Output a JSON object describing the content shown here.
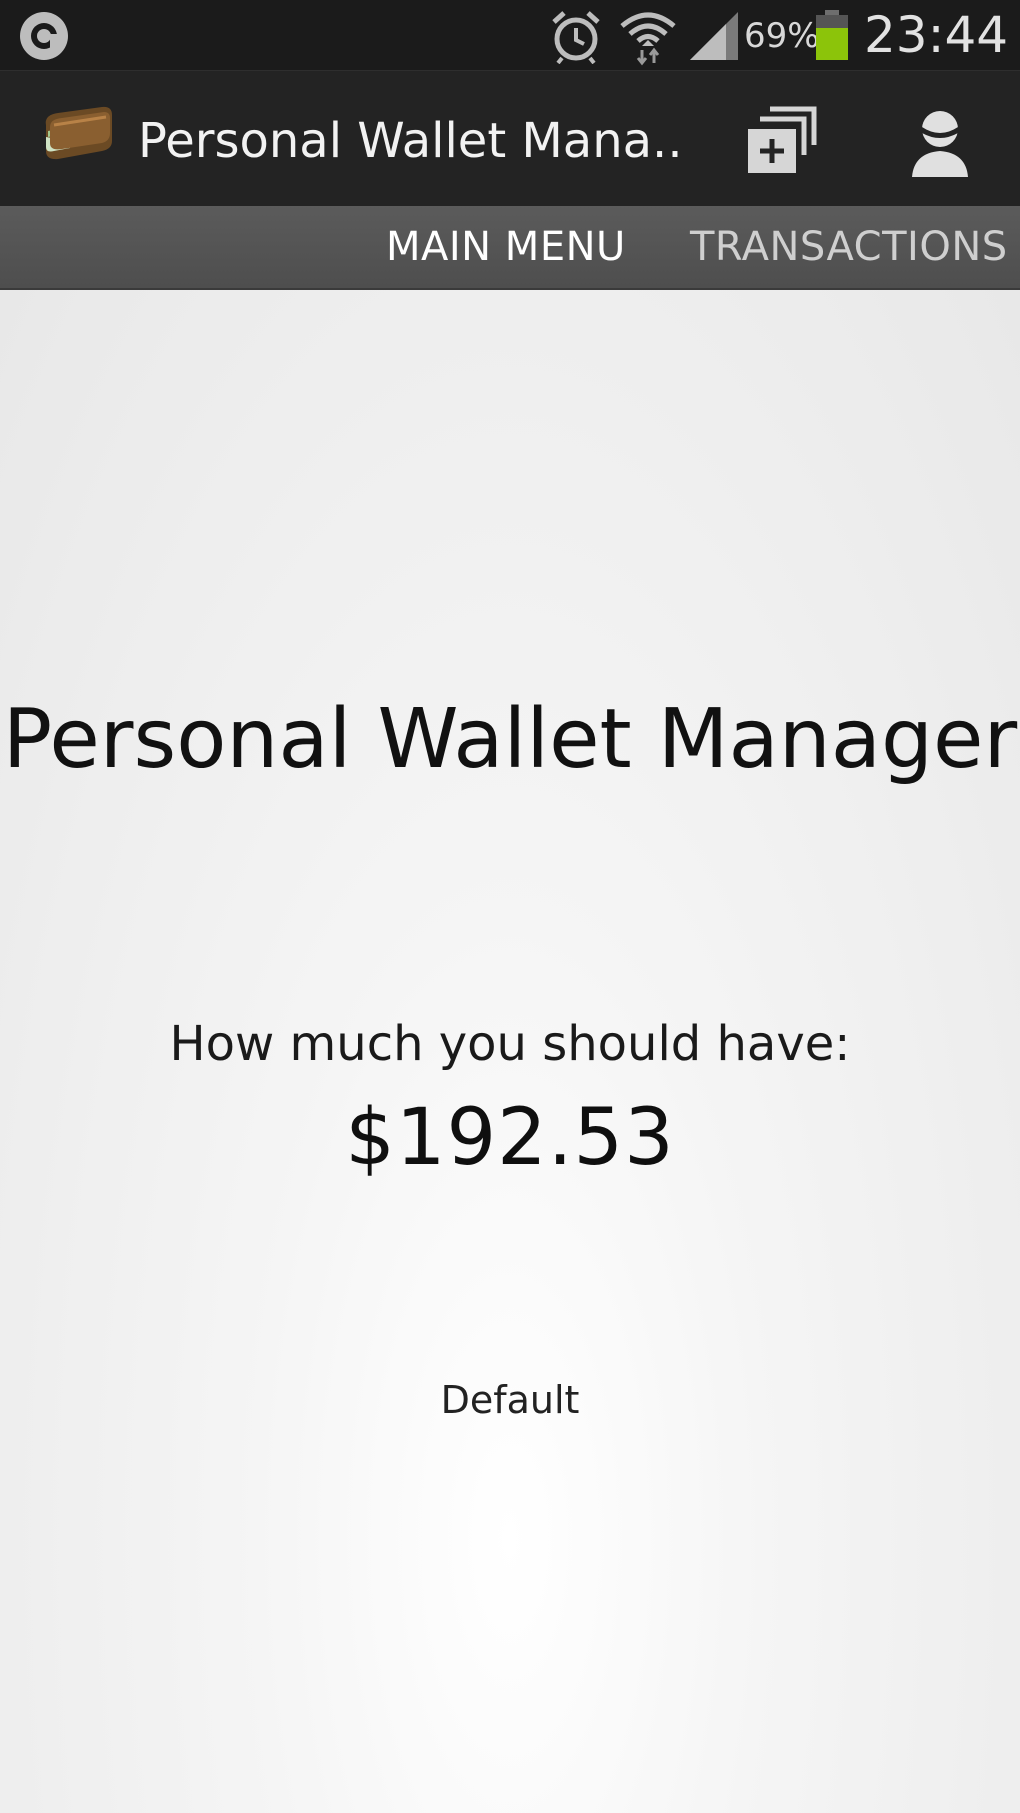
{
  "status_bar": {
    "battery_percent": "69%",
    "time": "23:44",
    "icons": [
      "app-notification-icon",
      "alarm-icon",
      "wifi-icon",
      "signal-icon",
      "battery-icon"
    ],
    "battery_color": "#8cc40a"
  },
  "action_bar": {
    "title": "Personal Wallet Mana...",
    "icons": [
      "wallet-app-icon",
      "add-account-icon",
      "profile-icon"
    ]
  },
  "tabs": [
    {
      "label": "MAIN MENU",
      "selected": true
    },
    {
      "label": "TRANSACTIONS",
      "selected": false
    }
  ],
  "main": {
    "heading": "Personal Wallet Manager",
    "balance_label": "How much you should have:",
    "balance_value": "$192.53",
    "wallet_name": "Default"
  }
}
